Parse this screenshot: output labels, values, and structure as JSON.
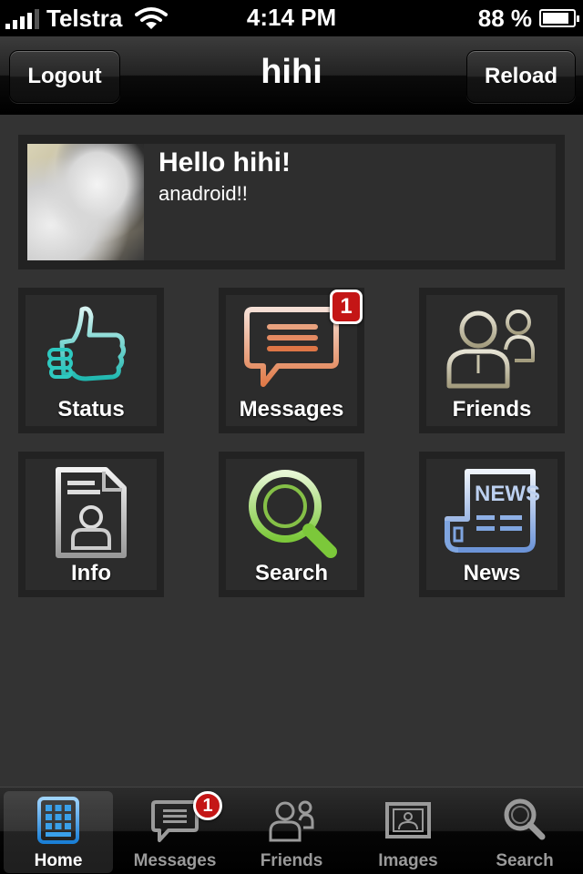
{
  "status_bar": {
    "carrier": "Telstra",
    "time": "4:14 PM",
    "battery": "88 %",
    "battery_level": 0.88
  },
  "nav_bar": {
    "title": "hihi",
    "left_button": "Logout",
    "right_button": "Reload"
  },
  "profile": {
    "greeting": "Hello hihi!",
    "subtitle": "anadroid!!"
  },
  "tiles": [
    {
      "label": "Status",
      "icon": "thumbs-up-icon"
    },
    {
      "label": "Messages",
      "icon": "speech-bubble-icon",
      "badge": "1"
    },
    {
      "label": "Friends",
      "icon": "people-icon"
    },
    {
      "label": "Info",
      "icon": "profile-document-icon"
    },
    {
      "label": "Search",
      "icon": "magnifier-icon"
    },
    {
      "label": "News",
      "icon": "newspaper-icon"
    }
  ],
  "tab_bar": {
    "active": "Home",
    "tabs": [
      {
        "label": "Home",
        "icon": "grid-icon"
      },
      {
        "label": "Messages",
        "icon": "speech-bubble-icon",
        "badge": "1"
      },
      {
        "label": "Friends",
        "icon": "people-icon"
      },
      {
        "label": "Images",
        "icon": "picture-frame-icon"
      },
      {
        "label": "Search",
        "icon": "magnifier-icon"
      }
    ]
  },
  "colors": {
    "background": "#333333",
    "tile": "#222222",
    "badge": "#c41616",
    "status_icon": "#2ec9c0",
    "messages_icon": "#e08a60",
    "friends_icon": "#b8b39a",
    "search_icon": "#8fd04a",
    "news_icon": "#7fa5e0",
    "home_tab_icon": "#3aa0ea"
  }
}
